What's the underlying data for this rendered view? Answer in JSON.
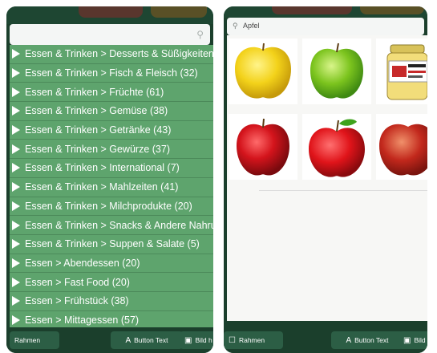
{
  "left": {
    "search": {
      "placeholder": ""
    },
    "categories": [
      "Essen & Trinken > Desserts & Süßigkeiten",
      "Essen & Trinken > Fisch & Fleisch (32)",
      "Essen & Trinken > Früchte (61)",
      "Essen & Trinken > Gemüse (38)",
      "Essen & Trinken > Getränke (43)",
      "Essen & Trinken > Gewürze (37)",
      "Essen & Trinken > International (7)",
      "Essen & Trinken > Mahlzeiten (41)",
      "Essen & Trinken > Milchprodukte (20)",
      "Essen & Trinken > Snacks & Andere Nahrung",
      "Essen & Trinken > Suppen & Salate (5)",
      "Essen > Abendessen (20)",
      "Essen > Fast Food (20)",
      "Essen > Frühstück (38)",
      "Essen > Mittagessen (57)"
    ],
    "footer": {
      "frame_label": "Rahmen",
      "text_button_label": "Button Text",
      "image_button_label": "Bild h"
    }
  },
  "right": {
    "search": {
      "value": "Apfel"
    },
    "footer": {
      "frame_label": "Rahmen",
      "text_button_label": "Button Text",
      "image_button_label": "Bild"
    }
  },
  "colors": {
    "dark_green": "#1b3f2c",
    "list_green": "#5ea46d",
    "white": "#ffffff"
  }
}
